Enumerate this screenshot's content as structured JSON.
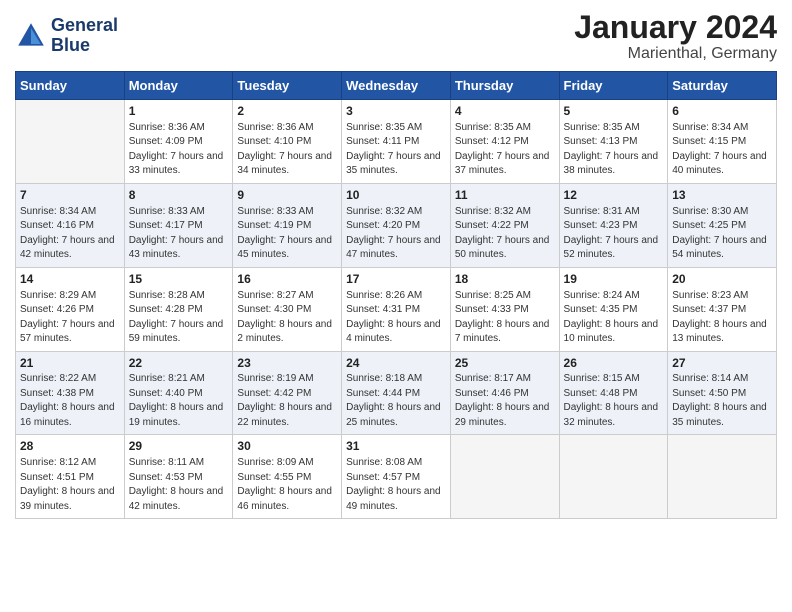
{
  "header": {
    "logo_line1": "General",
    "logo_line2": "Blue",
    "month_title": "January 2024",
    "location": "Marienthal, Germany"
  },
  "weekdays": [
    "Sunday",
    "Monday",
    "Tuesday",
    "Wednesday",
    "Thursday",
    "Friday",
    "Saturday"
  ],
  "weeks": [
    [
      {
        "day": "",
        "sunrise": "",
        "sunset": "",
        "daylight": ""
      },
      {
        "day": "1",
        "sunrise": "Sunrise: 8:36 AM",
        "sunset": "Sunset: 4:09 PM",
        "daylight": "Daylight: 7 hours and 33 minutes."
      },
      {
        "day": "2",
        "sunrise": "Sunrise: 8:36 AM",
        "sunset": "Sunset: 4:10 PM",
        "daylight": "Daylight: 7 hours and 34 minutes."
      },
      {
        "day": "3",
        "sunrise": "Sunrise: 8:35 AM",
        "sunset": "Sunset: 4:11 PM",
        "daylight": "Daylight: 7 hours and 35 minutes."
      },
      {
        "day": "4",
        "sunrise": "Sunrise: 8:35 AM",
        "sunset": "Sunset: 4:12 PM",
        "daylight": "Daylight: 7 hours and 37 minutes."
      },
      {
        "day": "5",
        "sunrise": "Sunrise: 8:35 AM",
        "sunset": "Sunset: 4:13 PM",
        "daylight": "Daylight: 7 hours and 38 minutes."
      },
      {
        "day": "6",
        "sunrise": "Sunrise: 8:34 AM",
        "sunset": "Sunset: 4:15 PM",
        "daylight": "Daylight: 7 hours and 40 minutes."
      }
    ],
    [
      {
        "day": "7",
        "sunrise": "Sunrise: 8:34 AM",
        "sunset": "Sunset: 4:16 PM",
        "daylight": "Daylight: 7 hours and 42 minutes."
      },
      {
        "day": "8",
        "sunrise": "Sunrise: 8:33 AM",
        "sunset": "Sunset: 4:17 PM",
        "daylight": "Daylight: 7 hours and 43 minutes."
      },
      {
        "day": "9",
        "sunrise": "Sunrise: 8:33 AM",
        "sunset": "Sunset: 4:19 PM",
        "daylight": "Daylight: 7 hours and 45 minutes."
      },
      {
        "day": "10",
        "sunrise": "Sunrise: 8:32 AM",
        "sunset": "Sunset: 4:20 PM",
        "daylight": "Daylight: 7 hours and 47 minutes."
      },
      {
        "day": "11",
        "sunrise": "Sunrise: 8:32 AM",
        "sunset": "Sunset: 4:22 PM",
        "daylight": "Daylight: 7 hours and 50 minutes."
      },
      {
        "day": "12",
        "sunrise": "Sunrise: 8:31 AM",
        "sunset": "Sunset: 4:23 PM",
        "daylight": "Daylight: 7 hours and 52 minutes."
      },
      {
        "day": "13",
        "sunrise": "Sunrise: 8:30 AM",
        "sunset": "Sunset: 4:25 PM",
        "daylight": "Daylight: 7 hours and 54 minutes."
      }
    ],
    [
      {
        "day": "14",
        "sunrise": "Sunrise: 8:29 AM",
        "sunset": "Sunset: 4:26 PM",
        "daylight": "Daylight: 7 hours and 57 minutes."
      },
      {
        "day": "15",
        "sunrise": "Sunrise: 8:28 AM",
        "sunset": "Sunset: 4:28 PM",
        "daylight": "Daylight: 7 hours and 59 minutes."
      },
      {
        "day": "16",
        "sunrise": "Sunrise: 8:27 AM",
        "sunset": "Sunset: 4:30 PM",
        "daylight": "Daylight: 8 hours and 2 minutes."
      },
      {
        "day": "17",
        "sunrise": "Sunrise: 8:26 AM",
        "sunset": "Sunset: 4:31 PM",
        "daylight": "Daylight: 8 hours and 4 minutes."
      },
      {
        "day": "18",
        "sunrise": "Sunrise: 8:25 AM",
        "sunset": "Sunset: 4:33 PM",
        "daylight": "Daylight: 8 hours and 7 minutes."
      },
      {
        "day": "19",
        "sunrise": "Sunrise: 8:24 AM",
        "sunset": "Sunset: 4:35 PM",
        "daylight": "Daylight: 8 hours and 10 minutes."
      },
      {
        "day": "20",
        "sunrise": "Sunrise: 8:23 AM",
        "sunset": "Sunset: 4:37 PM",
        "daylight": "Daylight: 8 hours and 13 minutes."
      }
    ],
    [
      {
        "day": "21",
        "sunrise": "Sunrise: 8:22 AM",
        "sunset": "Sunset: 4:38 PM",
        "daylight": "Daylight: 8 hours and 16 minutes."
      },
      {
        "day": "22",
        "sunrise": "Sunrise: 8:21 AM",
        "sunset": "Sunset: 4:40 PM",
        "daylight": "Daylight: 8 hours and 19 minutes."
      },
      {
        "day": "23",
        "sunrise": "Sunrise: 8:19 AM",
        "sunset": "Sunset: 4:42 PM",
        "daylight": "Daylight: 8 hours and 22 minutes."
      },
      {
        "day": "24",
        "sunrise": "Sunrise: 8:18 AM",
        "sunset": "Sunset: 4:44 PM",
        "daylight": "Daylight: 8 hours and 25 minutes."
      },
      {
        "day": "25",
        "sunrise": "Sunrise: 8:17 AM",
        "sunset": "Sunset: 4:46 PM",
        "daylight": "Daylight: 8 hours and 29 minutes."
      },
      {
        "day": "26",
        "sunrise": "Sunrise: 8:15 AM",
        "sunset": "Sunset: 4:48 PM",
        "daylight": "Daylight: 8 hours and 32 minutes."
      },
      {
        "day": "27",
        "sunrise": "Sunrise: 8:14 AM",
        "sunset": "Sunset: 4:50 PM",
        "daylight": "Daylight: 8 hours and 35 minutes."
      }
    ],
    [
      {
        "day": "28",
        "sunrise": "Sunrise: 8:12 AM",
        "sunset": "Sunset: 4:51 PM",
        "daylight": "Daylight: 8 hours and 39 minutes."
      },
      {
        "day": "29",
        "sunrise": "Sunrise: 8:11 AM",
        "sunset": "Sunset: 4:53 PM",
        "daylight": "Daylight: 8 hours and 42 minutes."
      },
      {
        "day": "30",
        "sunrise": "Sunrise: 8:09 AM",
        "sunset": "Sunset: 4:55 PM",
        "daylight": "Daylight: 8 hours and 46 minutes."
      },
      {
        "day": "31",
        "sunrise": "Sunrise: 8:08 AM",
        "sunset": "Sunset: 4:57 PM",
        "daylight": "Daylight: 8 hours and 49 minutes."
      },
      {
        "day": "",
        "sunrise": "",
        "sunset": "",
        "daylight": ""
      },
      {
        "day": "",
        "sunrise": "",
        "sunset": "",
        "daylight": ""
      },
      {
        "day": "",
        "sunrise": "",
        "sunset": "",
        "daylight": ""
      }
    ]
  ]
}
